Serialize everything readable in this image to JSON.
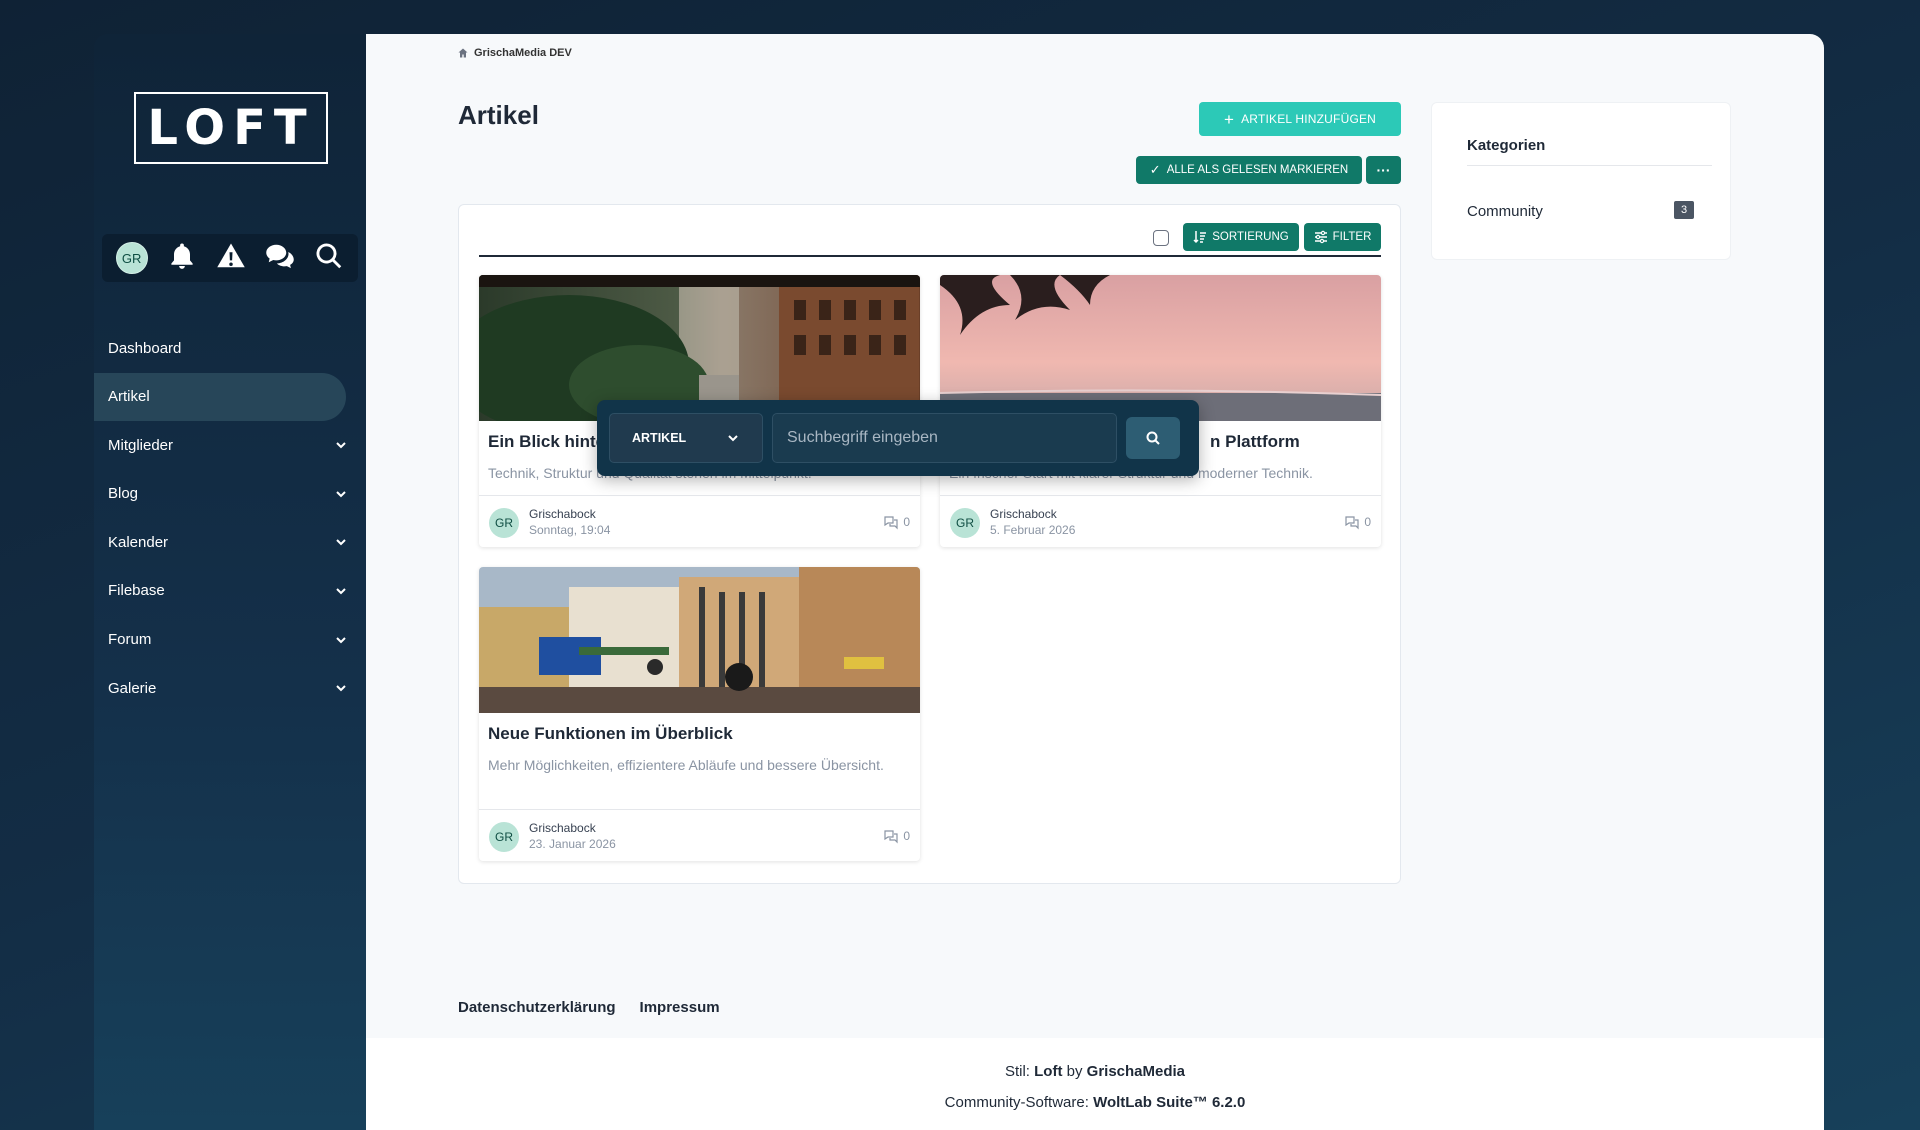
{
  "sidebar": {
    "logo": "LOFT",
    "user_initials": "GR",
    "icons": [
      "bell-icon",
      "warning-icon",
      "chat-icon",
      "search-icon"
    ],
    "items": [
      {
        "label": "Dashboard",
        "expandable": false,
        "active": false
      },
      {
        "label": "Artikel",
        "expandable": false,
        "active": true
      },
      {
        "label": "Mitglieder",
        "expandable": true,
        "active": false
      },
      {
        "label": "Blog",
        "expandable": true,
        "active": false
      },
      {
        "label": "Kalender",
        "expandable": true,
        "active": false
      },
      {
        "label": "Filebase",
        "expandable": true,
        "active": false
      },
      {
        "label": "Forum",
        "expandable": true,
        "active": false
      },
      {
        "label": "Galerie",
        "expandable": true,
        "active": false
      }
    ]
  },
  "breadcrumb": {
    "label": "GrischaMedia DEV"
  },
  "page": {
    "title": "Artikel",
    "add_button": "ARTIKEL HINZUFÜGEN",
    "mark_read_button": "ALLE ALS GELESEN MARKIEREN",
    "more_button": "···",
    "sort_button": "SORTIERUNG",
    "filter_button": "FILTER"
  },
  "articles": [
    {
      "title": "Ein Blick hinter die Kulissen der neuen Plattform",
      "visible_title": "Ein Blick hinte",
      "description": "Technik, Struktur und Qualität stehen im Mittelpunkt.",
      "author": "Grischabock",
      "date": "Sonntag, 19:04",
      "comments": "0"
    },
    {
      "title": "Willkommen auf der neuen Plattform",
      "visible_title": "n Plattform",
      "description": "Ein frischer Start mit klarer Struktur und moderner Technik.",
      "author": "Grischabock",
      "date": "5. Februar 2026",
      "comments": "0"
    },
    {
      "title": "Neue Funktionen im Überblick",
      "visible_title": "Neue Funktionen im Überblick",
      "description": "Mehr Möglichkeiten, effizientere Abläufe und bessere Übersicht.",
      "author": "Grischabock",
      "date": "23. Januar 2026",
      "comments": "0"
    }
  ],
  "search": {
    "scope": "ARTIKEL",
    "placeholder": "Suchbegriff eingeben"
  },
  "categories": {
    "title": "Kategorien",
    "items": [
      {
        "label": "Community",
        "count": "3"
      }
    ]
  },
  "footer": {
    "privacy": "Datenschutzerklärung",
    "imprint": "Impressum",
    "style_prefix": "Stil:",
    "style_name": "Loft",
    "style_by": "by",
    "style_author": "GrischaMedia",
    "software_prefix": "Community-Software:",
    "software_name": "WoltLab Suite™ 6.2.0"
  },
  "colors": {
    "accent": "#2cc9b7",
    "button_dark": "#107968",
    "sidebar_bg": "#0f2438",
    "search_overlay": "#113449"
  }
}
